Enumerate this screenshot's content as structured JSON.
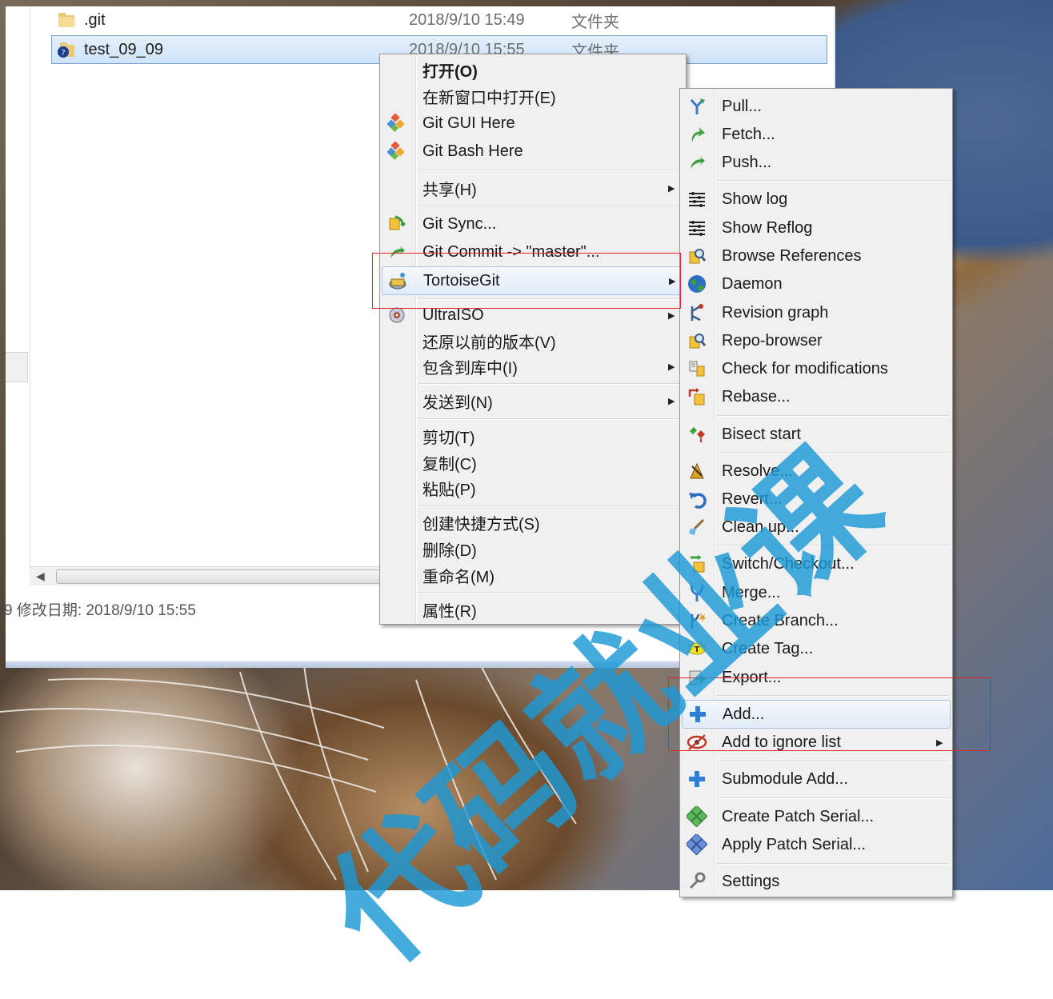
{
  "explorer": {
    "files": [
      {
        "name": ".git",
        "date": "2018/9/10 15:49",
        "type": "文件夹",
        "icon": "folder-icon"
      },
      {
        "name": "test_09_09",
        "date": "2018/9/10 15:55",
        "type": "文件夹",
        "icon": "tortoisegit-folder-icon",
        "selected": true
      }
    ],
    "details": "9 修改日期: 2018/9/10 15:55"
  },
  "context_menu": {
    "items": [
      {
        "label": "打开(O)",
        "bold": true
      },
      {
        "label": "在新窗口中打开(E)"
      },
      {
        "label": "Git GUI Here",
        "icon": "git-gui-icon"
      },
      {
        "label": "Git Bash Here",
        "icon": "git-bash-icon"
      },
      {
        "label": "共享(H)",
        "submenu": true
      },
      {
        "label": "Git Sync...",
        "icon": "git-sync-icon"
      },
      {
        "label": "Git Commit -> \"master\"...",
        "icon": "git-commit-icon"
      },
      {
        "label": "TortoiseGit",
        "icon": "tortoisegit-icon",
        "submenu": true,
        "highlighted": true
      },
      {
        "label": "UltraISO",
        "icon": "ultraiso-icon",
        "submenu": true
      },
      {
        "label": "还原以前的版本(V)"
      },
      {
        "label": "包含到库中(I)",
        "submenu": true
      },
      {
        "label": "发送到(N)",
        "submenu": true
      },
      {
        "label": "剪切(T)"
      },
      {
        "label": "复制(C)"
      },
      {
        "label": "粘贴(P)"
      },
      {
        "label": "创建快捷方式(S)"
      },
      {
        "label": "删除(D)"
      },
      {
        "label": "重命名(M)"
      },
      {
        "label": "属性(R)"
      }
    ]
  },
  "tortoisegit_menu": {
    "items": [
      {
        "label": "Pull...",
        "icon": "pull-icon"
      },
      {
        "label": "Fetch...",
        "icon": "fetch-icon"
      },
      {
        "label": "Push...",
        "icon": "push-icon"
      },
      {
        "label": "Show log",
        "icon": "log-icon"
      },
      {
        "label": "Show Reflog",
        "icon": "reflog-icon"
      },
      {
        "label": "Browse References",
        "icon": "references-icon"
      },
      {
        "label": "Daemon",
        "icon": "globe-icon"
      },
      {
        "label": "Revision graph",
        "icon": "revision-graph-icon"
      },
      {
        "label": "Repo-browser",
        "icon": "repo-browser-icon"
      },
      {
        "label": "Check for modifications",
        "icon": "check-modifications-icon"
      },
      {
        "label": "Rebase...",
        "icon": "rebase-icon"
      },
      {
        "label": "Bisect start",
        "icon": "bisect-icon"
      },
      {
        "label": "Resolve...",
        "icon": "resolve-icon"
      },
      {
        "label": "Revert...",
        "icon": "revert-icon"
      },
      {
        "label": "Clean up...",
        "icon": "cleanup-icon"
      },
      {
        "label": "Switch/Checkout...",
        "icon": "switch-icon"
      },
      {
        "label": "Merge...",
        "icon": "merge-icon"
      },
      {
        "label": "Create Branch...",
        "icon": "branch-icon"
      },
      {
        "label": "Create Tag...",
        "icon": "tag-icon"
      },
      {
        "label": "Export...",
        "icon": "export-icon"
      },
      {
        "label": "Add...",
        "icon": "add-icon",
        "highlighted": true
      },
      {
        "label": "Add to ignore list",
        "icon": "ignore-icon",
        "submenu": true
      },
      {
        "label": "Submodule Add...",
        "icon": "submodule-add-icon"
      },
      {
        "label": "Create Patch Serial...",
        "icon": "create-patch-icon"
      },
      {
        "label": "Apply Patch Serial...",
        "icon": "apply-patch-icon"
      },
      {
        "label": "Settings",
        "icon": "settings-icon"
      }
    ]
  },
  "watermark": "代码就业课",
  "colors": {
    "highlight_box": "#e0262b",
    "watermark": "#1c98d6",
    "menu_bg": "#f0f0f0"
  }
}
